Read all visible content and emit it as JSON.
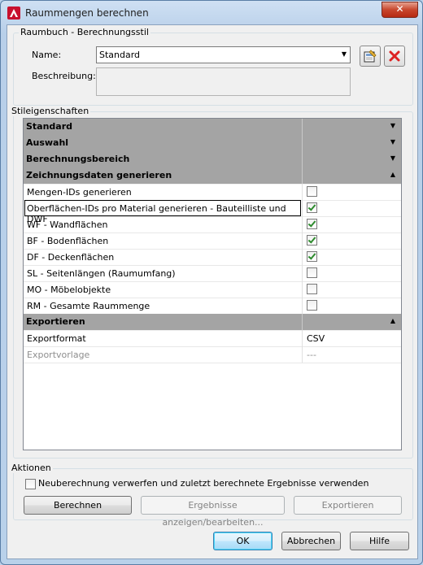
{
  "window": {
    "title": "Raummengen berechnen",
    "close_symbol": "✕",
    "icon": "autocad-a-icon"
  },
  "raumbuch": {
    "group_label": "Raumbuch - Berechnungsstil",
    "name_label": "Name:",
    "name_value": "Standard",
    "description_label": "Beschreibung:",
    "description_value": "",
    "edit_icon": "edit-style-icon",
    "delete_icon": "delete-red-x-icon"
  },
  "stil": {
    "group_label": "Stileigenschaften",
    "rows": [
      {
        "type": "category",
        "label": "Standard",
        "expanded": false
      },
      {
        "type": "category",
        "label": "Auswahl",
        "expanded": false
      },
      {
        "type": "category",
        "label": "Berechnungsbereich",
        "expanded": false
      },
      {
        "type": "category",
        "label": "Zeichnungsdaten generieren",
        "expanded": true
      },
      {
        "type": "check",
        "label": "Mengen-IDs generieren",
        "checked": false
      },
      {
        "type": "check",
        "label": "Oberflächen-IDs pro Material generieren - Bauteilliste und DWF",
        "checked": true,
        "selected": true
      },
      {
        "type": "check",
        "label": "WF - Wandflächen",
        "checked": true
      },
      {
        "type": "check",
        "label": "BF - Bodenflächen",
        "checked": true
      },
      {
        "type": "check",
        "label": "DF - Deckenflächen",
        "checked": true
      },
      {
        "type": "check",
        "label": "SL - Seitenlängen (Raumumfang)",
        "checked": false
      },
      {
        "type": "check",
        "label": "MO - Möbelobjekte",
        "checked": false
      },
      {
        "type": "check",
        "label": "RM - Gesamte Raummenge",
        "checked": false
      },
      {
        "type": "category",
        "label": "Exportieren",
        "expanded": true
      },
      {
        "type": "value",
        "label": "Exportformat",
        "value": "CSV"
      },
      {
        "type": "value",
        "label": "Exportvorlage",
        "value": "---",
        "disabled": true
      }
    ]
  },
  "aktionen": {
    "group_label": "Aktionen",
    "discard_label": "Neuberechnung verwerfen und zuletzt berechnete Ergebnisse verwenden",
    "discard_checked": false,
    "berechnen": "Berechnen",
    "ergebnisse": "Ergebnisse anzeigen/bearbeiten...",
    "exportieren": "Exportieren"
  },
  "footer": {
    "ok": "OK",
    "abbrechen": "Abbrechen",
    "hilfe": "Hilfe"
  }
}
